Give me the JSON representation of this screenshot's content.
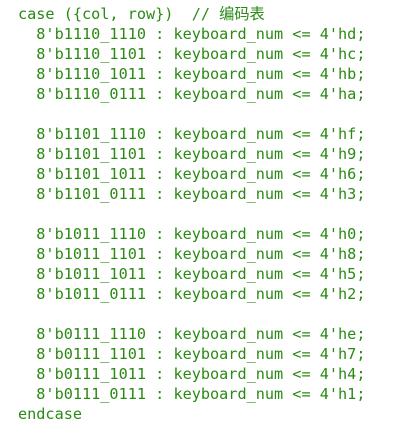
{
  "code": {
    "header": {
      "statement": "case ({col, row})  ",
      "comment": "// 编码表"
    },
    "groups": [
      {
        "rows": [
          "  8'b1110_1110 : keyboard_num <= 4'hd;",
          "  8'b1110_1101 : keyboard_num <= 4'hc;",
          "  8'b1110_1011 : keyboard_num <= 4'hb;",
          "  8'b1110_0111 : keyboard_num <= 4'ha;"
        ]
      },
      {
        "rows": [
          "  8'b1101_1110 : keyboard_num <= 4'hf;",
          "  8'b1101_1101 : keyboard_num <= 4'h9;",
          "  8'b1101_1011 : keyboard_num <= 4'h6;",
          "  8'b1101_0111 : keyboard_num <= 4'h3;"
        ]
      },
      {
        "rows": [
          "  8'b1011_1110 : keyboard_num <= 4'h0;",
          "  8'b1011_1101 : keyboard_num <= 4'h8;",
          "  8'b1011_1011 : keyboard_num <= 4'h5;",
          "  8'b1011_0111 : keyboard_num <= 4'h2;"
        ]
      },
      {
        "rows": [
          "  8'b0111_1110 : keyboard_num <= 4'he;",
          "  8'b0111_1101 : keyboard_num <= 4'h7;",
          "  8'b0111_1011 : keyboard_num <= 4'h4;",
          "  8'b0111_0111 : keyboard_num <= 4'h1;"
        ]
      }
    ],
    "footer": "endcase"
  },
  "colors": {
    "text": "#2a8a14",
    "background": "#ffffff"
  }
}
